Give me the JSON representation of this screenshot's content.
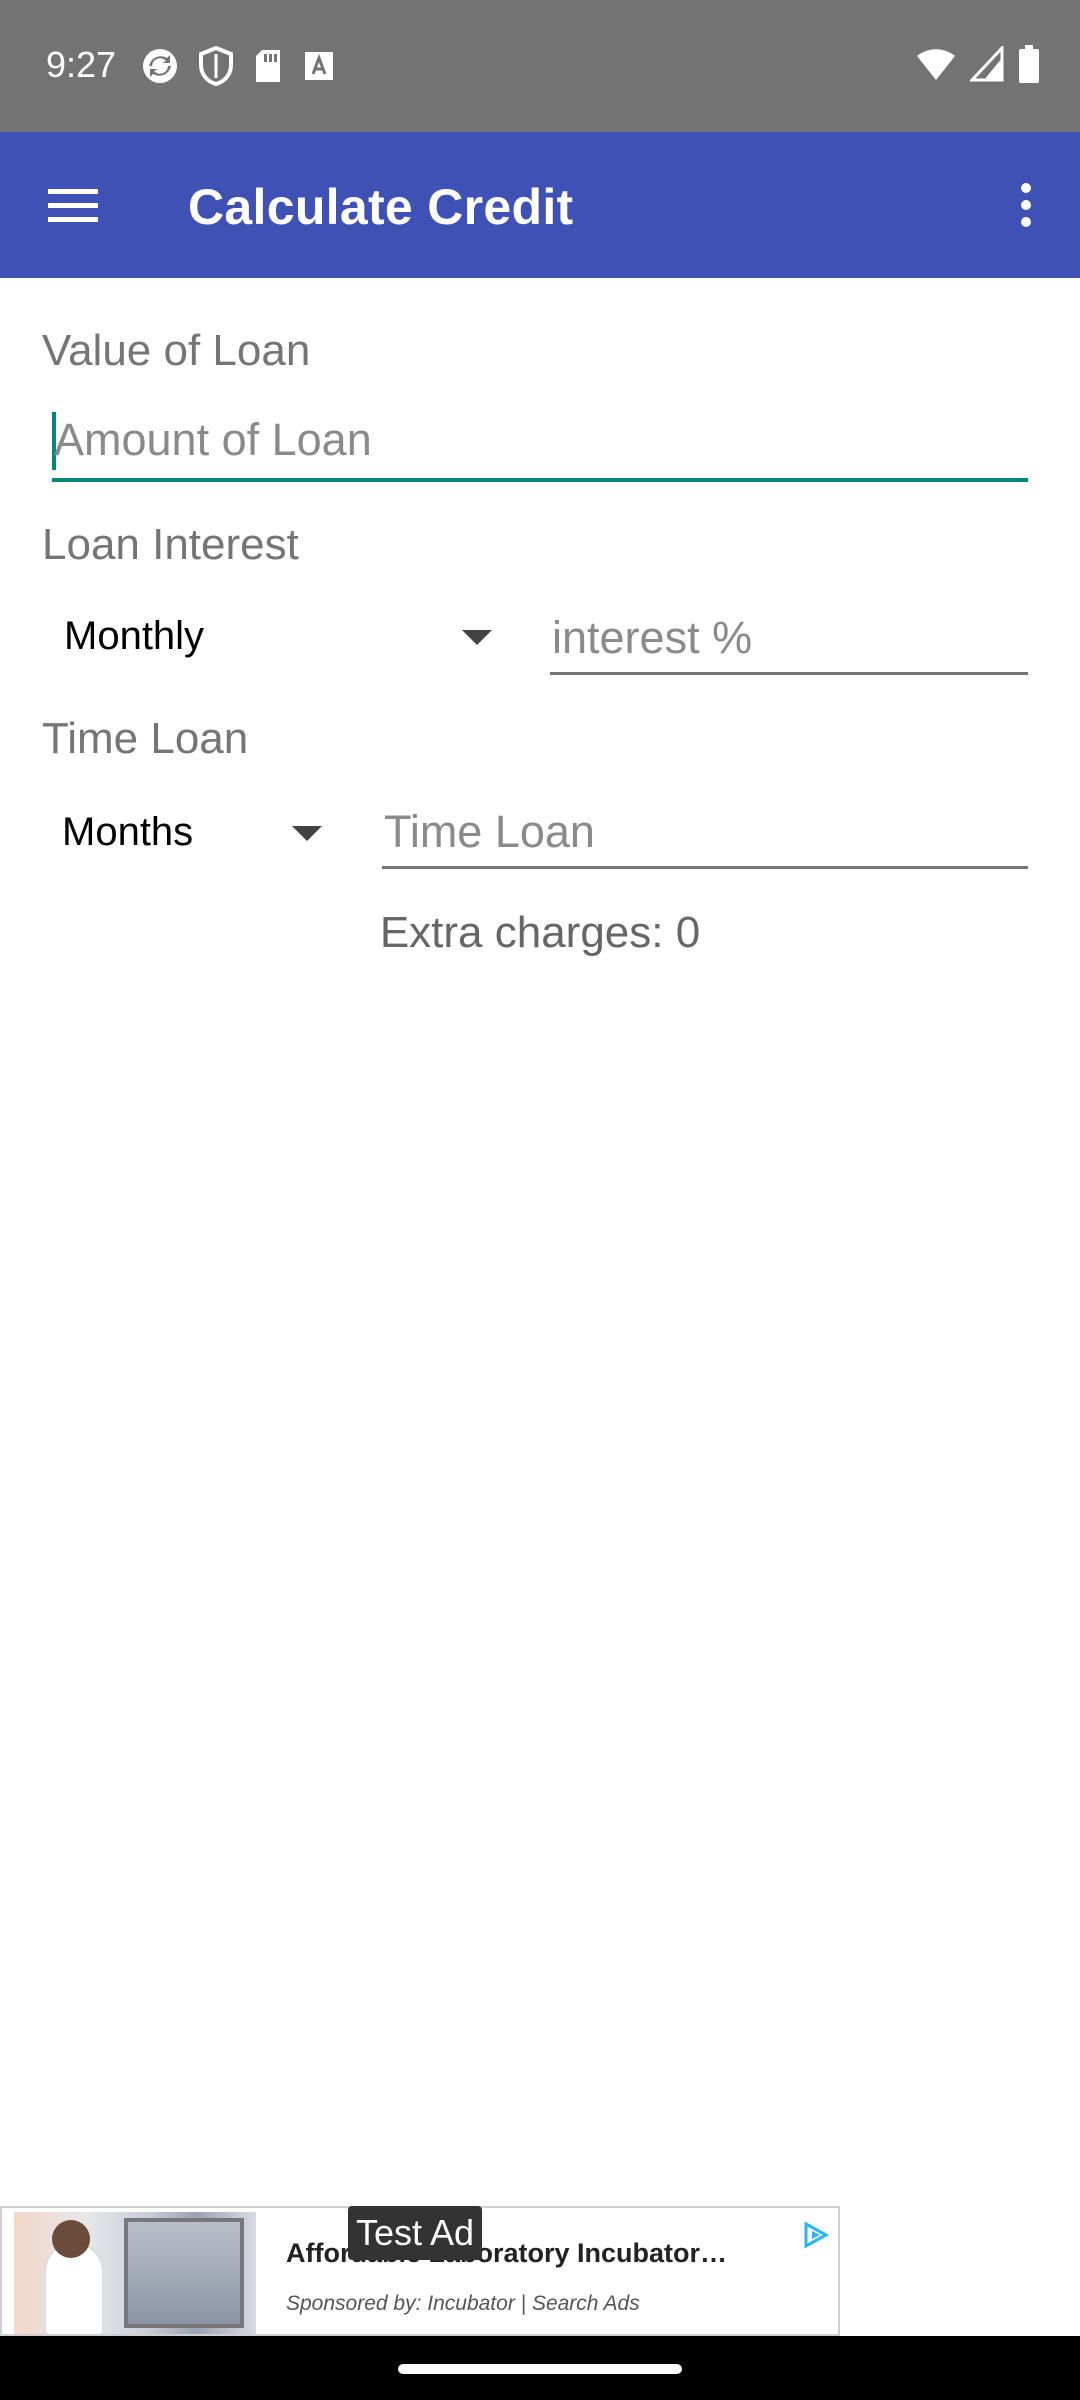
{
  "status_bar": {
    "time": "9:27",
    "left_icons": [
      "sync-icon",
      "shield-icon",
      "sd-card-icon",
      "font-icon"
    ],
    "right_icons": [
      "wifi-icon",
      "signal-icon",
      "battery-icon"
    ]
  },
  "app_bar": {
    "title": "Calculate Credit",
    "background": "#3f51b5",
    "menu_icon": "hamburger-menu-icon",
    "overflow_icon": "more-vertical-icon"
  },
  "form": {
    "loan_value": {
      "label": "Value of Loan",
      "placeholder": "Amount of Loan",
      "value": ""
    },
    "interest": {
      "label": "Loan Interest",
      "period_selected": "Monthly",
      "placeholder": "interest %",
      "value": ""
    },
    "time": {
      "label": "Time Loan",
      "unit_selected": "Months",
      "placeholder": "Time Loan",
      "value": ""
    },
    "extra_charges": "Extra charges: 0"
  },
  "ad": {
    "badge": "Test Ad",
    "title": "Affordable Laboratory Incubator…",
    "sponsor": "Sponsored by: Incubator | Search Ads"
  },
  "colors": {
    "accent": "#00897b",
    "status_bar": "#737373"
  }
}
